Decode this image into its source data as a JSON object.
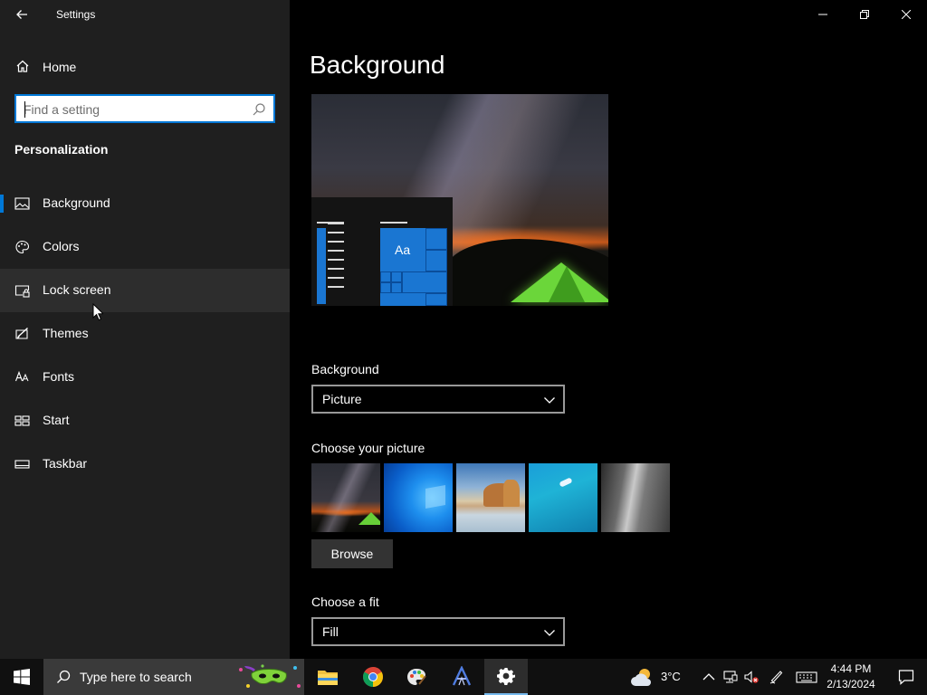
{
  "window": {
    "title": "Settings"
  },
  "sidebar": {
    "home_label": "Home",
    "search_placeholder": "Find a setting",
    "section_title": "Personalization",
    "items": [
      {
        "label": "Background",
        "icon": "picture-icon",
        "selected": true
      },
      {
        "label": "Colors",
        "icon": "palette-icon"
      },
      {
        "label": "Lock screen",
        "icon": "lock-screen-icon",
        "hovered": true
      },
      {
        "label": "Themes",
        "icon": "brush-icon"
      },
      {
        "label": "Fonts",
        "icon": "font-icon"
      },
      {
        "label": "Start",
        "icon": "start-icon"
      },
      {
        "label": "Taskbar",
        "icon": "taskbar-icon"
      }
    ]
  },
  "main": {
    "page_title": "Background",
    "preview": {
      "sample_text": "Aa"
    },
    "background_field": {
      "label": "Background",
      "value": "Picture"
    },
    "choose_picture": {
      "label": "Choose your picture",
      "browse_label": "Browse"
    },
    "fit_field": {
      "label": "Choose a fit",
      "value": "Fill"
    }
  },
  "taskbar": {
    "search_placeholder": "Type here to search",
    "weather_temp": "3°C",
    "time": "4:44 PM",
    "date": "2/13/2024"
  },
  "colors": {
    "accent": "#0078d7",
    "sidebar_bg": "#1f1f1f",
    "content_bg": "#000000",
    "taskbar_bg": "#101010"
  }
}
